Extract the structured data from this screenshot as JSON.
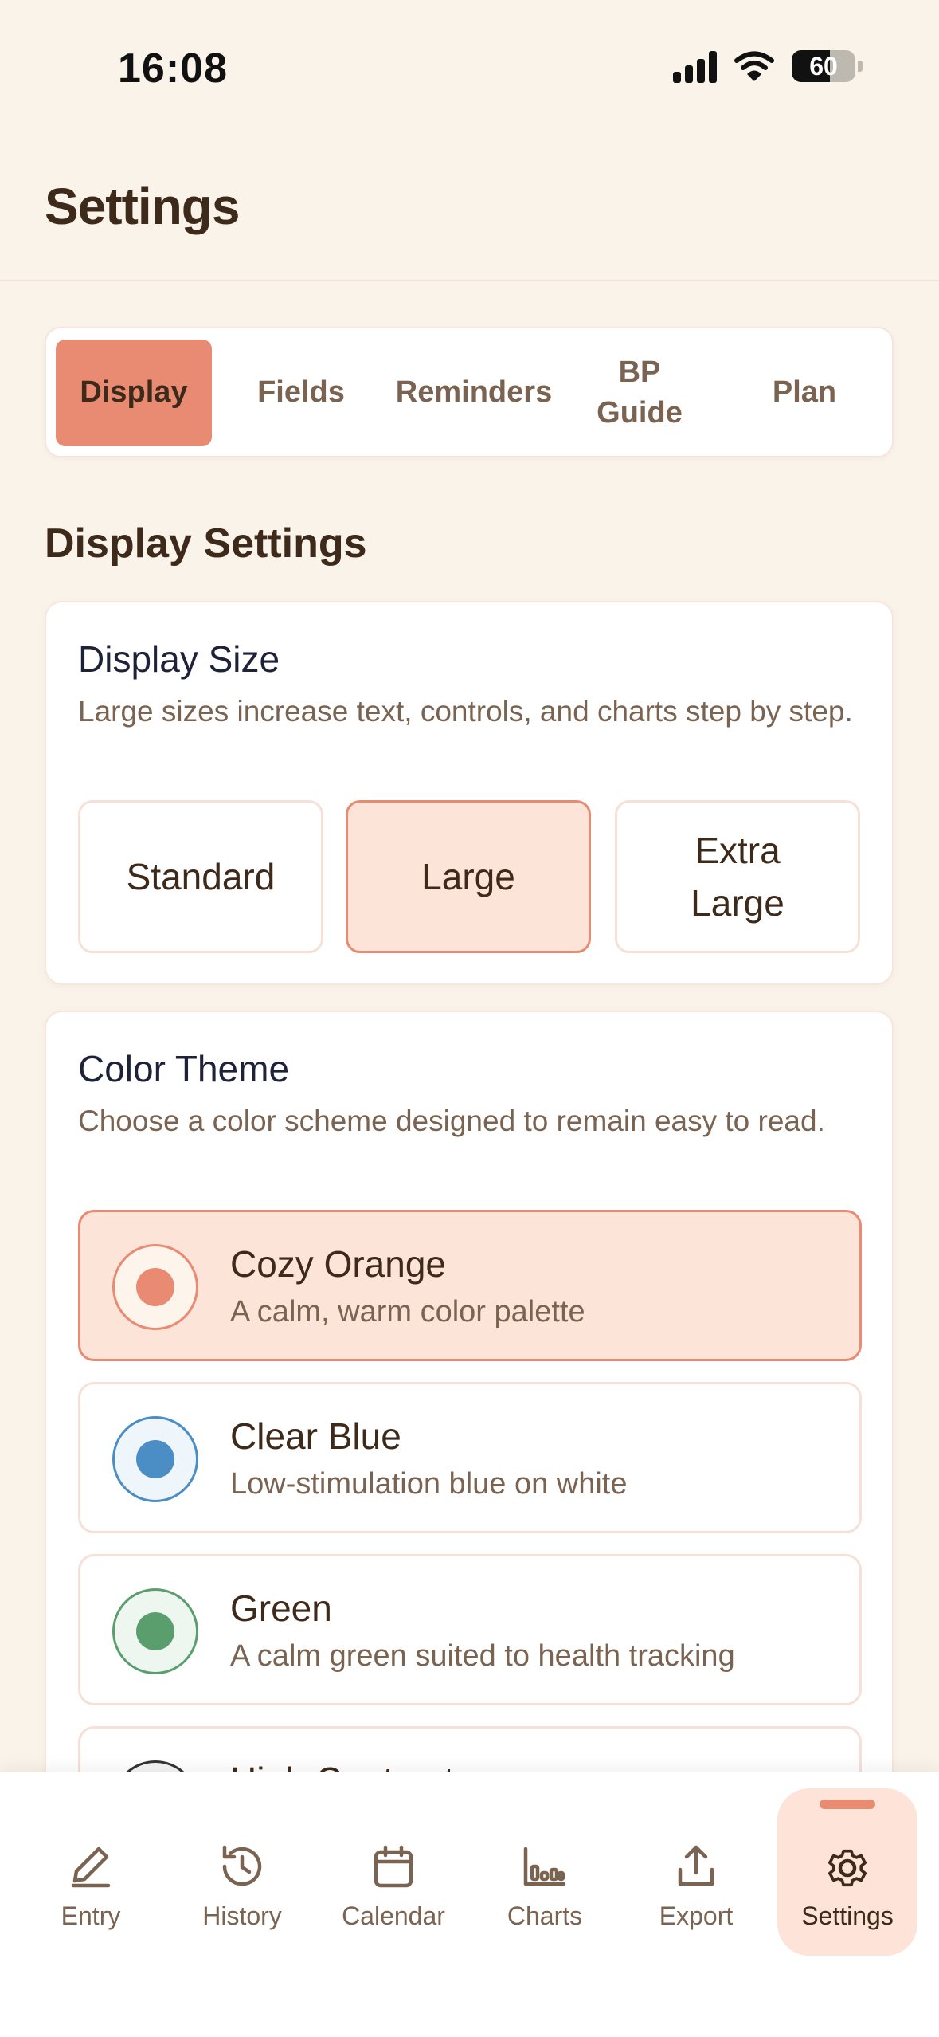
{
  "status_bar": {
    "time": "16:08",
    "battery": "60"
  },
  "header": {
    "title": "Settings"
  },
  "tabs": [
    {
      "label": "Display",
      "active": true
    },
    {
      "label": "Fields",
      "active": false
    },
    {
      "label": "Reminders",
      "active": false
    },
    {
      "label": "BP Guide",
      "active": false
    },
    {
      "label": "Plan",
      "active": false
    }
  ],
  "section": {
    "heading": "Display Settings"
  },
  "display_size": {
    "title": "Display Size",
    "description": "Large sizes increase text, controls, and charts step by step.",
    "options": [
      {
        "label": "Standard",
        "selected": false
      },
      {
        "label": "Large",
        "selected": true
      },
      {
        "label": "Extra Large",
        "selected": false
      }
    ]
  },
  "color_theme": {
    "title": "Color Theme",
    "description": "Choose a color scheme designed to remain easy to read.",
    "options": [
      {
        "name": "Cozy Orange",
        "description": "A calm, warm color palette",
        "selected": true,
        "color": "#e98a72"
      },
      {
        "name": "Clear Blue",
        "description": "Low-stimulation blue on white",
        "selected": false,
        "color": "#4a8ec5"
      },
      {
        "name": "Green",
        "description": "A calm green suited to health tracking",
        "selected": false,
        "color": "#5a9e6e"
      },
      {
        "name": "High Contrast",
        "description": "",
        "selected": false,
        "color": "#333333"
      }
    ]
  },
  "bottom_nav": [
    {
      "label": "Entry",
      "icon": "pencil-icon",
      "active": false
    },
    {
      "label": "History",
      "icon": "history-icon",
      "active": false
    },
    {
      "label": "Calendar",
      "icon": "calendar-icon",
      "active": false
    },
    {
      "label": "Charts",
      "icon": "chart-icon",
      "active": false
    },
    {
      "label": "Export",
      "icon": "export-icon",
      "active": false
    },
    {
      "label": "Settings",
      "icon": "gear-icon",
      "active": true
    }
  ],
  "colors": {
    "accent": "#e98a72",
    "accent_light": "#fce4d9",
    "background": "#faf3ea",
    "text_primary": "#3d2a1a",
    "text_secondary": "#7a6350"
  }
}
